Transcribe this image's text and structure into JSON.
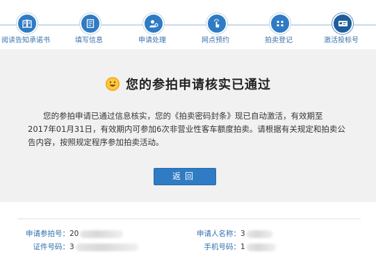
{
  "steps": [
    {
      "label": "阅读告知承诺书",
      "icon": "book-icon"
    },
    {
      "label": "填写信息",
      "icon": "form-icon"
    },
    {
      "label": "申请处理",
      "icon": "user-process-icon"
    },
    {
      "label": "网点预约",
      "icon": "touch-icon"
    },
    {
      "label": "拍卖登记",
      "icon": "dots-icon"
    },
    {
      "label": "激活投标号",
      "icon": "card-icon"
    }
  ],
  "result": {
    "title": "您的参拍申请核实已通过",
    "message_line1": "您的参拍申请已通过信息核实，您的《拍卖密码封条》现已自动激活，有效期至",
    "message_rest": "2017年01月31日，有效期内可参加6次非营业性客车额度拍卖。请根据有关规定和拍卖公告内容，按照规定程序参加拍卖活动。",
    "back_button": "返回"
  },
  "info": {
    "application_no_label": "申请参拍号：",
    "application_no_value": "20",
    "applicant_name_label": "申请人名称：",
    "applicant_name_value": "3",
    "id_no_label": "证件号码：",
    "id_no_value": "3",
    "phone_label": "手机号码：",
    "phone_value": "1"
  },
  "colors": {
    "accent": "#2f7bc4",
    "label_blue": "#2f6fae",
    "panel_bg": "#f1f1f1",
    "smiley": "#f5a81c"
  }
}
